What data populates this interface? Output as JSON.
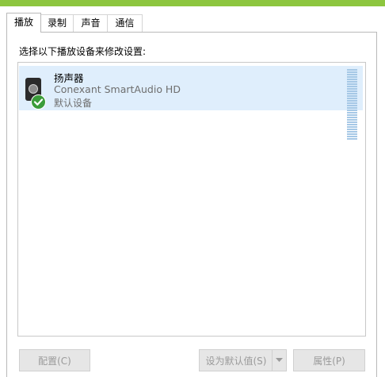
{
  "tabs": [
    {
      "label": "播放",
      "active": true
    },
    {
      "label": "录制",
      "active": false
    },
    {
      "label": "声音",
      "active": false
    },
    {
      "label": "通信",
      "active": false
    }
  ],
  "prompt": "选择以下播放设备来修改设置:",
  "device": {
    "name": "扬声器",
    "subtitle": "Conexant SmartAudio HD",
    "status": "默认设备",
    "icon": "speaker-icon",
    "badge_icon": "check-icon"
  },
  "buttons": {
    "configure": "配置(C)",
    "set_default": "设为默认值(S)",
    "properties": "属性(P)"
  },
  "colors": {
    "accent": "#8dc63f",
    "selection": "#dfeefc",
    "check": "#3a9c3a",
    "meter": "#a6c8e6"
  }
}
